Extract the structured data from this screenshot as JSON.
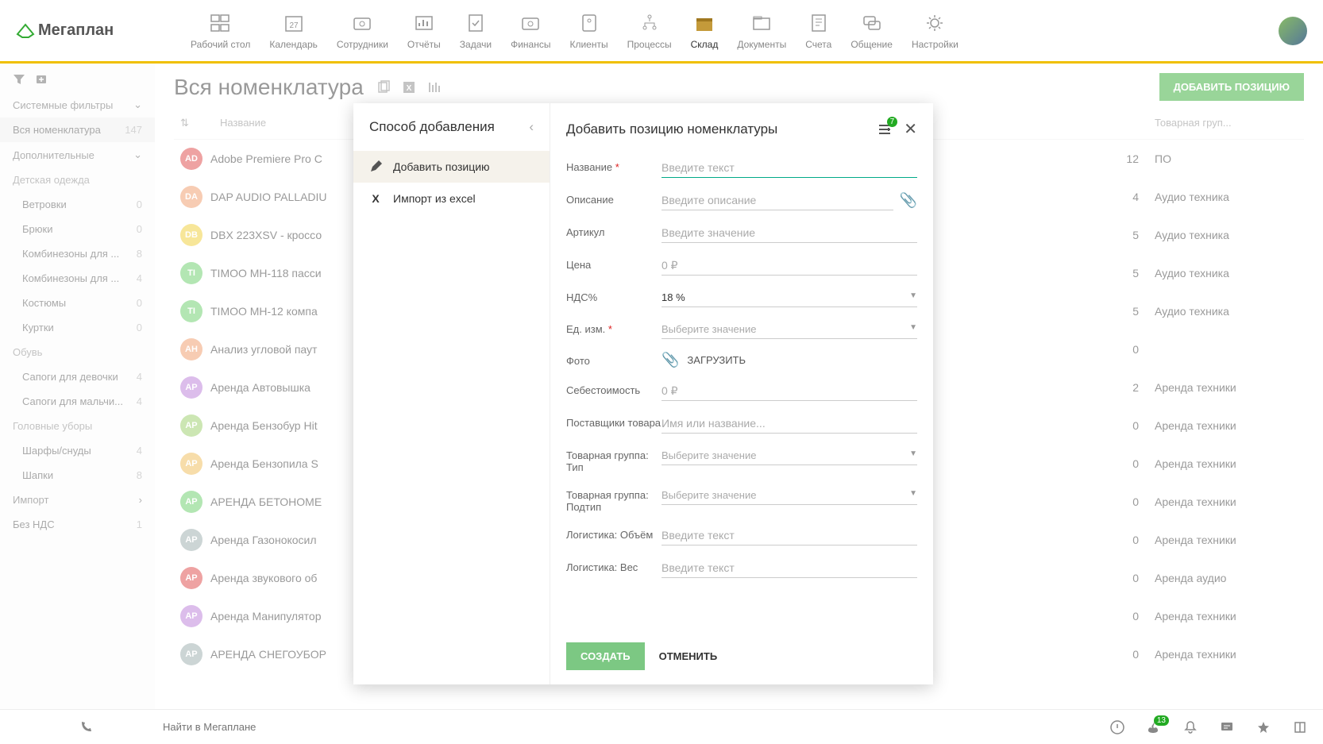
{
  "logo": "Мегаплан",
  "nav": [
    {
      "label": "Рабочий стол"
    },
    {
      "label": "Календарь"
    },
    {
      "label": "Сотрудники"
    },
    {
      "label": "Отчёты"
    },
    {
      "label": "Задачи"
    },
    {
      "label": "Финансы"
    },
    {
      "label": "Клиенты"
    },
    {
      "label": "Процессы"
    },
    {
      "label": "Склад"
    },
    {
      "label": "Документы"
    },
    {
      "label": "Счета"
    },
    {
      "label": "Общение"
    },
    {
      "label": "Настройки"
    }
  ],
  "sidebar": {
    "system_filters_title": "Системные фильтры",
    "all_nom": {
      "label": "Вся номенклатура",
      "count": "147"
    },
    "additional_title": "Дополнительные",
    "groups": [
      {
        "name": "Детская одежда",
        "items": [
          {
            "label": "Ветровки",
            "count": "0"
          },
          {
            "label": "Брюки",
            "count": "0"
          },
          {
            "label": "Комбинезоны для ...",
            "count": "8"
          },
          {
            "label": "Комбинезоны для ...",
            "count": "4"
          },
          {
            "label": "Костюмы",
            "count": "0"
          },
          {
            "label": "Куртки",
            "count": "0"
          }
        ]
      },
      {
        "name": "Обувь",
        "items": [
          {
            "label": "Сапоги для девочки",
            "count": "4"
          },
          {
            "label": "Сапоги для мальчи...",
            "count": "4"
          }
        ]
      },
      {
        "name": "Головные уборы",
        "items": [
          {
            "label": "Шарфы/снуды",
            "count": "4"
          },
          {
            "label": "Шапки",
            "count": "8"
          }
        ]
      }
    ],
    "import_label": "Импорт",
    "no_vat": {
      "label": "Без НДС",
      "count": "1"
    }
  },
  "page": {
    "title": "Вся номенклатура",
    "add_button": "ДОБАВИТЬ ПОЗИЦИЮ",
    "cols": {
      "name": "Название",
      "group": "Товарная груп..."
    },
    "rows": [
      {
        "badge": "AD",
        "color": "#d44",
        "name": "Adobe Premiere Pro C",
        "qty": "12",
        "group": "ПО"
      },
      {
        "badge": "DA",
        "color": "#e96",
        "name": "DAP AUDIO PALLADIU",
        "qty": "4",
        "group": "Аудио техника"
      },
      {
        "badge": "DB",
        "color": "#ec3",
        "name": "DBX 223XSV - кроссо",
        "qty": "5",
        "group": "Аудио техника"
      },
      {
        "badge": "TI",
        "color": "#6c6",
        "name": "TIMOO MH-118 пасси",
        "qty": "5",
        "group": "Аудио техника"
      },
      {
        "badge": "TI",
        "color": "#6c6",
        "name": "TIMOO MH-12 компа",
        "qty": "5",
        "group": "Аудио техника"
      },
      {
        "badge": "АН",
        "color": "#e96",
        "name": "Анализ угловой паут",
        "qty": "0",
        "group": ""
      },
      {
        "badge": "АР",
        "color": "#b87bd6",
        "name": "Аренда Автовышка",
        "qty": "2",
        "group": "Аренда техники"
      },
      {
        "badge": "АР",
        "color": "#9c6",
        "name": "Аренда Бензобур Hit",
        "qty": "0",
        "group": "Аренда техники"
      },
      {
        "badge": "АР",
        "color": "#eb5",
        "name": "Аренда Бензопила S",
        "qty": "0",
        "group": "Аренда техники"
      },
      {
        "badge": "АР",
        "color": "#6c6",
        "name": "АРЕНДА БЕТОНОМЕ",
        "qty": "0",
        "group": "Аренда техники"
      },
      {
        "badge": "АР",
        "color": "#9aa",
        "name": "Аренда Газонокосил",
        "qty": "0",
        "group": "Аренда техники"
      },
      {
        "badge": "АР",
        "color": "#d44",
        "name": "Аренда звукового об",
        "qty": "0",
        "group": "Аренда аудио"
      },
      {
        "badge": "АР",
        "color": "#b87bd6",
        "name": "Аренда Манипулятор",
        "qty": "0",
        "group": "Аренда техники"
      },
      {
        "badge": "АР",
        "color": "#9aa",
        "name": "АРЕНДА СНЕГОУБОР",
        "qty": "0",
        "group": "Аренда техники"
      }
    ]
  },
  "modal": {
    "left_title": "Способ добавления",
    "add_position": "Добавить позицию",
    "import_excel": "Импорт из excel",
    "right_title": "Добавить позицию номенклатуры",
    "badge_count": "7",
    "fields": {
      "name": {
        "label": "Название",
        "placeholder": "Введите текст"
      },
      "desc": {
        "label": "Описание",
        "placeholder": "Введите описание"
      },
      "article": {
        "label": "Артикул",
        "placeholder": "Введите значение"
      },
      "price": {
        "label": "Цена",
        "value": "0 ₽"
      },
      "vat": {
        "label": "НДС%",
        "value": "18 %"
      },
      "unit": {
        "label": "Ед. изм.",
        "placeholder": "Выберите значение"
      },
      "photo": {
        "label": "Фото",
        "upload": "ЗАГРУЗИТЬ"
      },
      "cost": {
        "label": "Себестоимость",
        "value": "0 ₽"
      },
      "suppliers": {
        "label": "Поставщики товара",
        "placeholder": "Имя или название..."
      },
      "group_type": {
        "label": "Товарная группа: Тип",
        "placeholder": "Выберите значение"
      },
      "group_subtype": {
        "label": "Товарная группа: Подтип",
        "placeholder": "Выберите значение"
      },
      "log_vol": {
        "label": "Логистика: Объём",
        "placeholder": "Введите текст"
      },
      "log_weight": {
        "label": "Логистика: Вес",
        "placeholder": "Введите текст"
      }
    },
    "create": "СОЗДАТЬ",
    "cancel": "ОТМЕНИТЬ"
  },
  "bottombar": {
    "search_placeholder": "Найти в Мегаплане",
    "fire_badge": "13"
  }
}
